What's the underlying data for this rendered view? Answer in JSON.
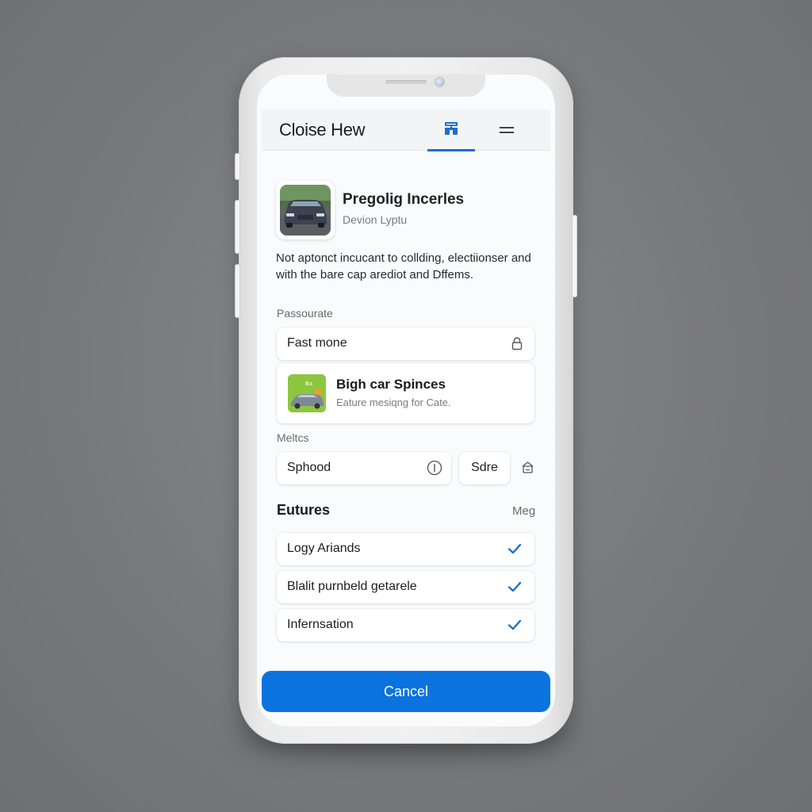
{
  "header": {
    "title": "Cloise Hew",
    "tab_icon": "sitemap-icon",
    "menu_icon": "menu-icon"
  },
  "app": {
    "name": "Pregolig Incerles",
    "subtitle": "Devion Lyptu",
    "thumbnail": "car-photo",
    "description": "Not aptonct incucant to collding, electiionser and with the bare cap arediot and Dffems."
  },
  "password_section": {
    "label": "Passourate",
    "field_value": "Fast mone",
    "field_icon": "lock-icon"
  },
  "promo": {
    "title": "Bigh car Spinces",
    "subtitle": "Eature mesiqng for Cate.",
    "thumbnail": "car-promo-image"
  },
  "metrics_section": {
    "label": "Meltcs",
    "field_value": "Sphood",
    "field_icon": "info-icon",
    "button_label": "Sdre",
    "side_icon": "home-icon"
  },
  "features": {
    "title": "Eutures",
    "link_label": "Meg",
    "items": [
      {
        "label": "Logy Ariands",
        "checked": true
      },
      {
        "label": "Blalit purnbeld getarele",
        "checked": true
      },
      {
        "label": "Infernsation",
        "checked": true
      }
    ]
  },
  "footer": {
    "cancel_label": "Cancel"
  },
  "colors": {
    "accent": "#0a73de",
    "tab_underline": "#1d6fc9",
    "check": "#1d6fc9",
    "background": "#77787c"
  }
}
